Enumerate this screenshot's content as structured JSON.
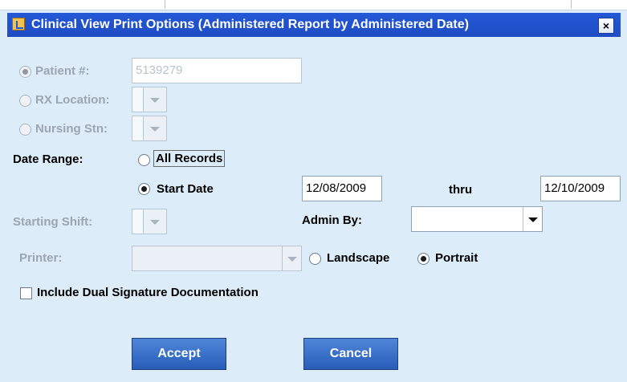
{
  "window": {
    "title": "Clinical View Print Options (Administered Report by Administered Date)",
    "close_glyph": "×"
  },
  "form": {
    "patient_label": "Patient #:",
    "patient_value": "5139279",
    "rx_location_label": "RX Location:",
    "nursing_stn_label": "Nursing Stn:",
    "date_range_label": "Date Range:",
    "all_records_label": "All Records",
    "start_date_label": "Start Date",
    "start_date_value": "12/08/2009",
    "thru_label": "thru",
    "end_date_value": "12/10/2009",
    "starting_shift_label": "Starting Shift:",
    "admin_by_label": "Admin By:",
    "admin_by_value": "",
    "printer_label": "Printer:",
    "printer_value": "",
    "landscape_label": "Landscape",
    "portrait_label": "Portrait",
    "dual_signature_label": "Include Dual Signature Documentation",
    "dual_signature_checked": false
  },
  "buttons": {
    "accept_label": "Accept",
    "cancel_label": "Cancel"
  },
  "icons": {
    "app": "clinical-app-icon",
    "dropdown": "chevron-down-icon"
  },
  "colors": {
    "background": "#dcecf8",
    "titlebar": "#2458d6",
    "button": "#3a6fc9"
  }
}
